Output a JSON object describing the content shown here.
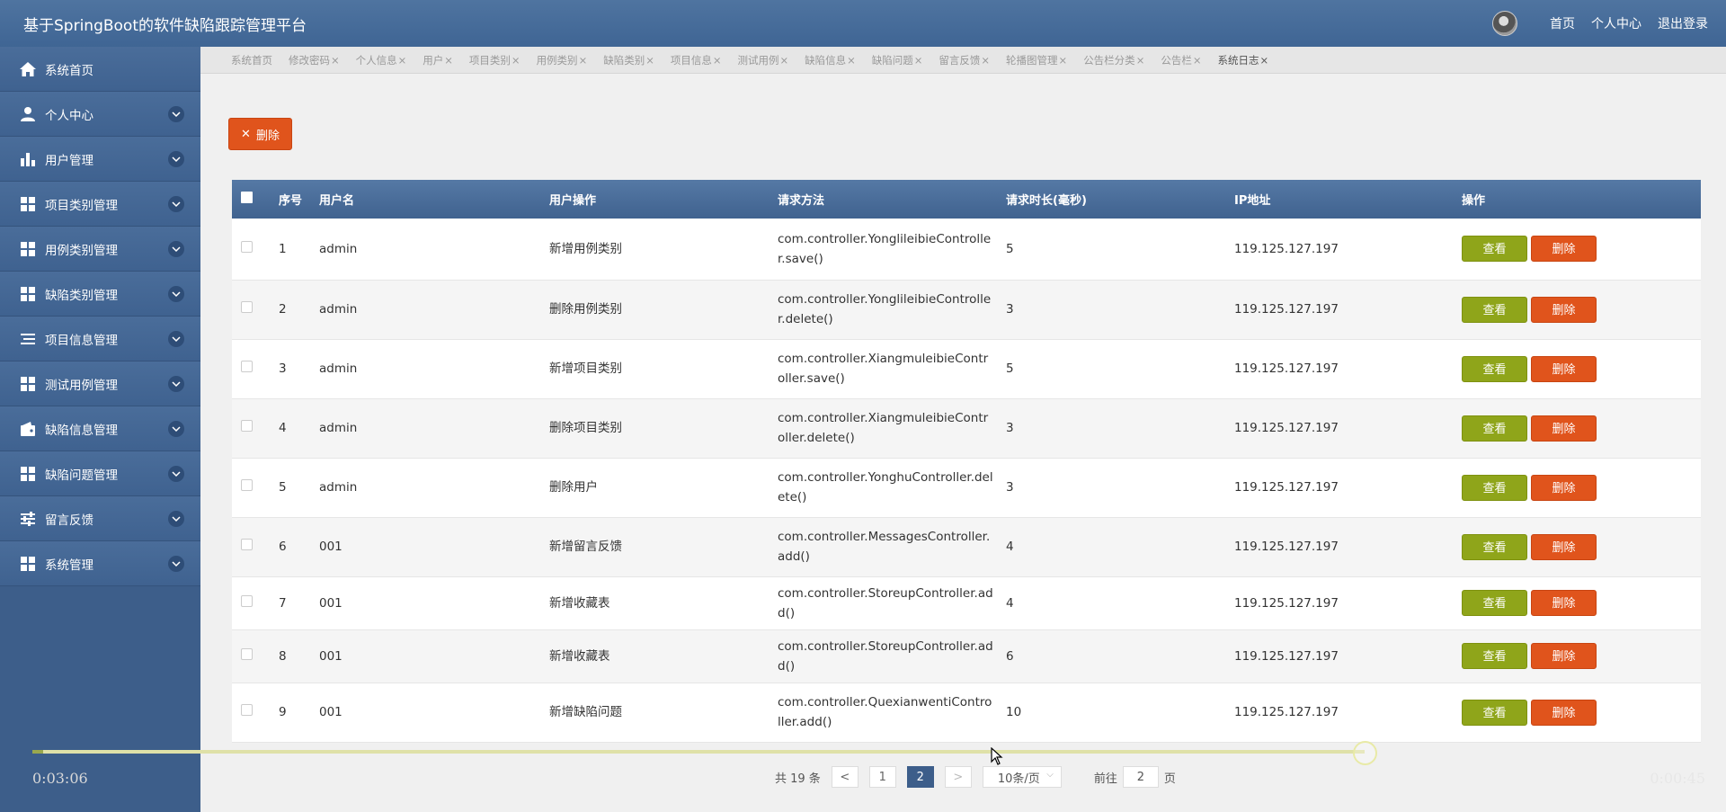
{
  "header": {
    "title": "基于SpringBoot的软件缺陷跟踪管理平台",
    "links": [
      "首页",
      "个人中心",
      "退出登录"
    ]
  },
  "sidebar": {
    "items": [
      {
        "label": "系统首页",
        "icon": "home-icon",
        "expandable": false
      },
      {
        "label": "个人中心",
        "icon": "user-icon",
        "expandable": true
      },
      {
        "label": "用户管理",
        "icon": "bar-chart-icon",
        "expandable": true
      },
      {
        "label": "项目类别管理",
        "icon": "grid-icon",
        "expandable": true
      },
      {
        "label": "用例类别管理",
        "icon": "grid-icon",
        "expandable": true
      },
      {
        "label": "缺陷类别管理",
        "icon": "grid-icon",
        "expandable": true
      },
      {
        "label": "项目信息管理",
        "icon": "list-icon",
        "expandable": true
      },
      {
        "label": "测试用例管理",
        "icon": "grid-icon",
        "expandable": true
      },
      {
        "label": "缺陷信息管理",
        "icon": "wallet-icon",
        "expandable": true
      },
      {
        "label": "缺陷问题管理",
        "icon": "grid-icon",
        "expandable": true
      },
      {
        "label": "留言反馈",
        "icon": "sliders-icon",
        "expandable": true
      },
      {
        "label": "系统管理",
        "icon": "grid-icon",
        "expandable": true
      }
    ]
  },
  "tabs": [
    {
      "label": "系统首页",
      "closable": false
    },
    {
      "label": "修改密码",
      "closable": true
    },
    {
      "label": "个人信息",
      "closable": true
    },
    {
      "label": "用户",
      "closable": true
    },
    {
      "label": "项目类别",
      "closable": true
    },
    {
      "label": "用例类别",
      "closable": true
    },
    {
      "label": "缺陷类别",
      "closable": true
    },
    {
      "label": "项目信息",
      "closable": true
    },
    {
      "label": "测试用例",
      "closable": true
    },
    {
      "label": "缺陷信息",
      "closable": true
    },
    {
      "label": "缺陷问题",
      "closable": true
    },
    {
      "label": "留言反馈",
      "closable": true
    },
    {
      "label": "轮播图管理",
      "closable": true
    },
    {
      "label": "公告栏分类",
      "closable": true
    },
    {
      "label": "公告栏",
      "closable": true
    },
    {
      "label": "系统日志",
      "closable": true,
      "active": true
    }
  ],
  "toolbar": {
    "delete_label": "删除",
    "delete_icon": "close-icon"
  },
  "table": {
    "columns": [
      "序号",
      "用户名",
      "用户操作",
      "请求方法",
      "请求时长(毫秒)",
      "IP地址",
      "操作"
    ],
    "view_label": "查看",
    "delete_label": "删除",
    "rows": [
      {
        "no": "1",
        "user": "admin",
        "op": "新增用例类别",
        "method": "com.controller.YonglileibieController.save()",
        "ms": "5",
        "ip": "119.125.127.197"
      },
      {
        "no": "2",
        "user": "admin",
        "op": "删除用例类别",
        "method": "com.controller.YonglileibieController.delete()",
        "ms": "3",
        "ip": "119.125.127.197"
      },
      {
        "no": "3",
        "user": "admin",
        "op": "新增项目类别",
        "method": "com.controller.XiangmuleibieController.save()",
        "ms": "5",
        "ip": "119.125.127.197"
      },
      {
        "no": "4",
        "user": "admin",
        "op": "删除项目类别",
        "method": "com.controller.XiangmuleibieController.delete()",
        "ms": "3",
        "ip": "119.125.127.197"
      },
      {
        "no": "5",
        "user": "admin",
        "op": "删除用户",
        "method": "com.controller.YonghuController.delete()",
        "ms": "3",
        "ip": "119.125.127.197"
      },
      {
        "no": "6",
        "user": "001",
        "op": "新增留言反馈",
        "method": "com.controller.MessagesController.add()",
        "ms": "4",
        "ip": "119.125.127.197"
      },
      {
        "no": "7",
        "user": "001",
        "op": "新增收藏表",
        "method": "com.controller.StoreupController.add()",
        "ms": "4",
        "ip": "119.125.127.197"
      },
      {
        "no": "8",
        "user": "001",
        "op": "新增收藏表",
        "method": "com.controller.StoreupController.add()",
        "ms": "6",
        "ip": "119.125.127.197"
      },
      {
        "no": "9",
        "user": "001",
        "op": "新增缺陷问题",
        "method": "com.controller.QuexianwentiController.add()",
        "ms": "10",
        "ip": "119.125.127.197"
      }
    ]
  },
  "pagination": {
    "total": "共 19 条",
    "prev": "<",
    "pages": [
      "1",
      "2"
    ],
    "current": "2",
    "next": ">",
    "page_size": "10条/页",
    "goto_label": "前往",
    "goto_value": "2",
    "page_suffix": "页"
  },
  "video": {
    "elapsed": "0:03:06",
    "remaining": "0:00:45",
    "progress": 0.8
  },
  "colors": {
    "header": "#4a6f9c",
    "sidebar": "#3d5e8a",
    "danger": "#e0541c",
    "view": "#8fa51a"
  }
}
